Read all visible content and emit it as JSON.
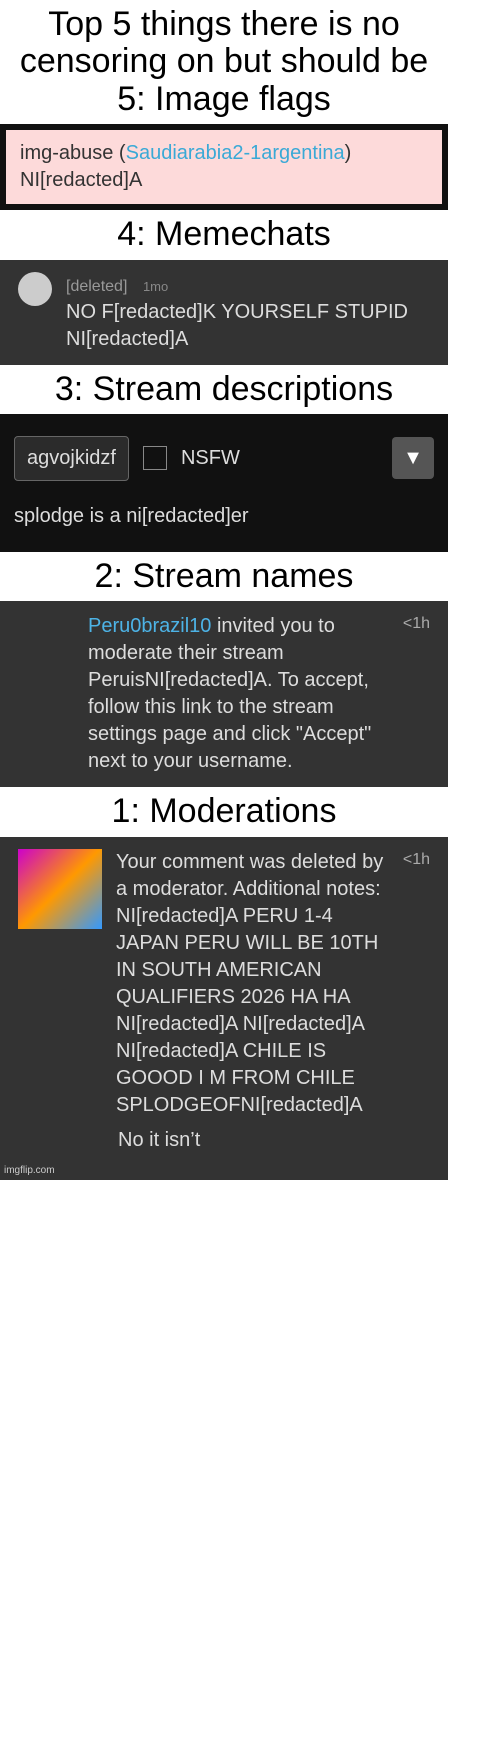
{
  "title_caption": "Top 5 things there is no censoring on but should be 5: Image flags",
  "flag": {
    "label": "img-abuse (",
    "user": "Saudiarabia2-1argentina",
    "close": ")",
    "text_masked": "NI[redacted]A"
  },
  "caption_4": "4: Memechats",
  "chat": {
    "user": "[deleted]",
    "age": "1mo",
    "text": "NO F[redacted]K YOURSELF STUPID NI[redacted]A"
  },
  "caption_3": "3: Stream descriptions",
  "stream_desc": {
    "select_value": "agvojkidzf",
    "nsfw_label": "NSFW",
    "dropdown_icon": "▼",
    "text": "splodge is a ni[redacted]er"
  },
  "caption_2": "2: Stream names",
  "invite": {
    "user": "Peru0brazil10",
    "text": "invited you to moderate their stream PeruisNI[redacted]A. To accept, follow this link to the stream settings page and click \"Accept\" next to your username.",
    "time": "<1h"
  },
  "caption_1": "1: Moderations",
  "moderation": {
    "text": "Your comment was deleted by a moderator. Additional notes: NI[redacted]A PERU 1-4 JAPAN PERU WILL BE 10TH IN SOUTH AMERICAN QUALIFIERS 2026 HA HA NI[redacted]A NI[redacted]A NI[redacted]A CHILE IS GOOOD I M FROM CHILE SPLODGEOFNI[redacted]A",
    "time": "<1h",
    "bottom_text": "No it isn’t",
    "credit": "imgflip.com"
  }
}
